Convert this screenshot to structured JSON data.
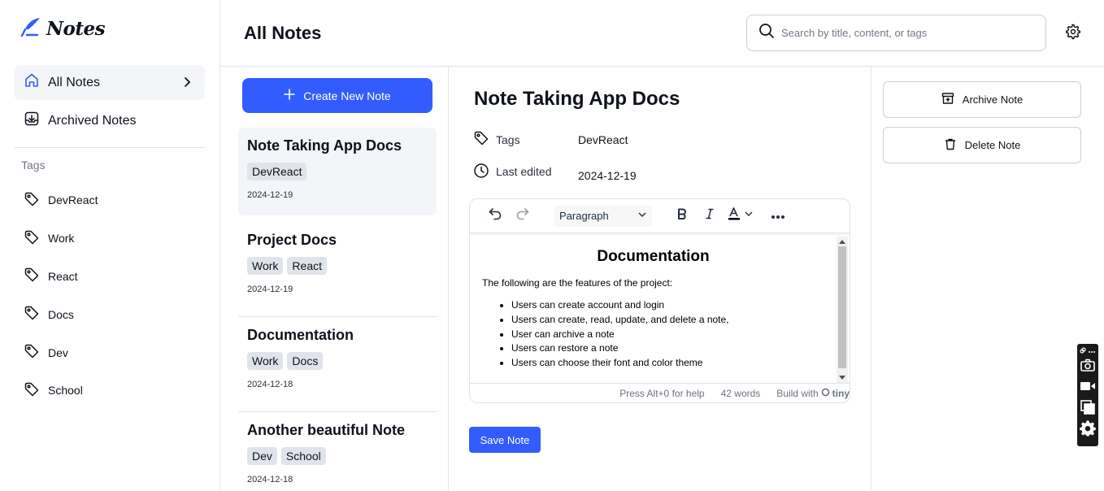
{
  "app": {
    "name": "Notes",
    "brand_color": "#335cff"
  },
  "sidebar": {
    "nav": [
      {
        "label": "All Notes",
        "icon": "home-icon",
        "active": true
      },
      {
        "label": "Archived Notes",
        "icon": "archive-icon",
        "active": false
      }
    ],
    "tags_heading": "Tags",
    "tags": [
      "DevReact",
      "Work",
      "React",
      "Docs",
      "Dev",
      "School"
    ]
  },
  "header": {
    "title": "All Notes",
    "search_placeholder": "Search by title, content, or tags"
  },
  "notes_list": {
    "create_label": "Create New Note",
    "notes": [
      {
        "title": "Note Taking App Docs",
        "tags": [
          "DevReact"
        ],
        "date": "2024-12-19",
        "active": true
      },
      {
        "title": "Project Docs",
        "tags": [
          "Work",
          "React"
        ],
        "date": "2024-12-19",
        "active": false
      },
      {
        "title": "Documentation",
        "tags": [
          "Work",
          "Docs"
        ],
        "date": "2024-12-18",
        "active": false
      },
      {
        "title": "Another beautiful Note",
        "tags": [
          "Dev",
          "School"
        ],
        "date": "2024-12-18",
        "active": false
      }
    ]
  },
  "editor": {
    "title": "Note Taking App Docs",
    "tags_label": "Tags",
    "tags_value": "DevReact",
    "last_edited_label": "Last edited",
    "last_edited_value": "2024-12-19",
    "toolbar": {
      "block_format": "Paragraph"
    },
    "content": {
      "heading": "Documentation",
      "intro": "The following are the features of the project:",
      "items": [
        "Users can create account and login",
        "Users can create, read, update, and delete a note,",
        "User can archive a note",
        "Users can restore a note",
        "Users can choose their font and color theme"
      ]
    },
    "status": {
      "help": "Press Alt+0 for help",
      "words": "42 words",
      "build": "Build with",
      "brand": "tiny"
    },
    "save_label": "Save Note"
  },
  "actions": {
    "archive_label": "Archive Note",
    "delete_label": "Delete Note"
  }
}
